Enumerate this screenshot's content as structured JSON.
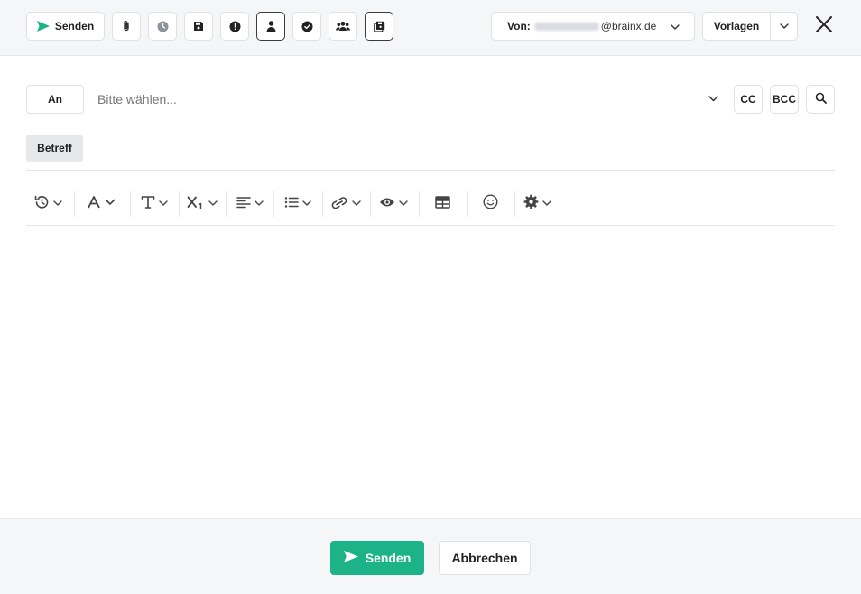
{
  "header": {
    "send_label": "Senden",
    "toolbar_icons": [
      "paperclip-icon",
      "clock-icon",
      "save-icon",
      "exclamation-icon",
      "person-icon",
      "check-circle-icon",
      "group-icon",
      "save-copy-icon"
    ],
    "from": {
      "label": "Von:",
      "domain": "@brainx.de"
    },
    "templates_label": "Vorlagen"
  },
  "recipients": {
    "to_label": "An",
    "to_placeholder": "Bitte wählen...",
    "cc_label": "CC",
    "bcc_label": "BCC"
  },
  "subject": {
    "label": "Betreff",
    "value": ""
  },
  "editor_toolbar": [
    "history-icon",
    "font-color-icon",
    "text-format-icon",
    "subscript-icon",
    "align-left-icon",
    "list-icon",
    "link-icon",
    "preview-icon",
    "table-icon",
    "emoji-icon",
    "settings-icon"
  ],
  "editor": {
    "content": ""
  },
  "footer": {
    "send_label": "Senden",
    "cancel_label": "Abbrechen"
  },
  "colors": {
    "accent": "#1db389",
    "background": "#f5f6f8",
    "border": "#dfe1e5"
  }
}
